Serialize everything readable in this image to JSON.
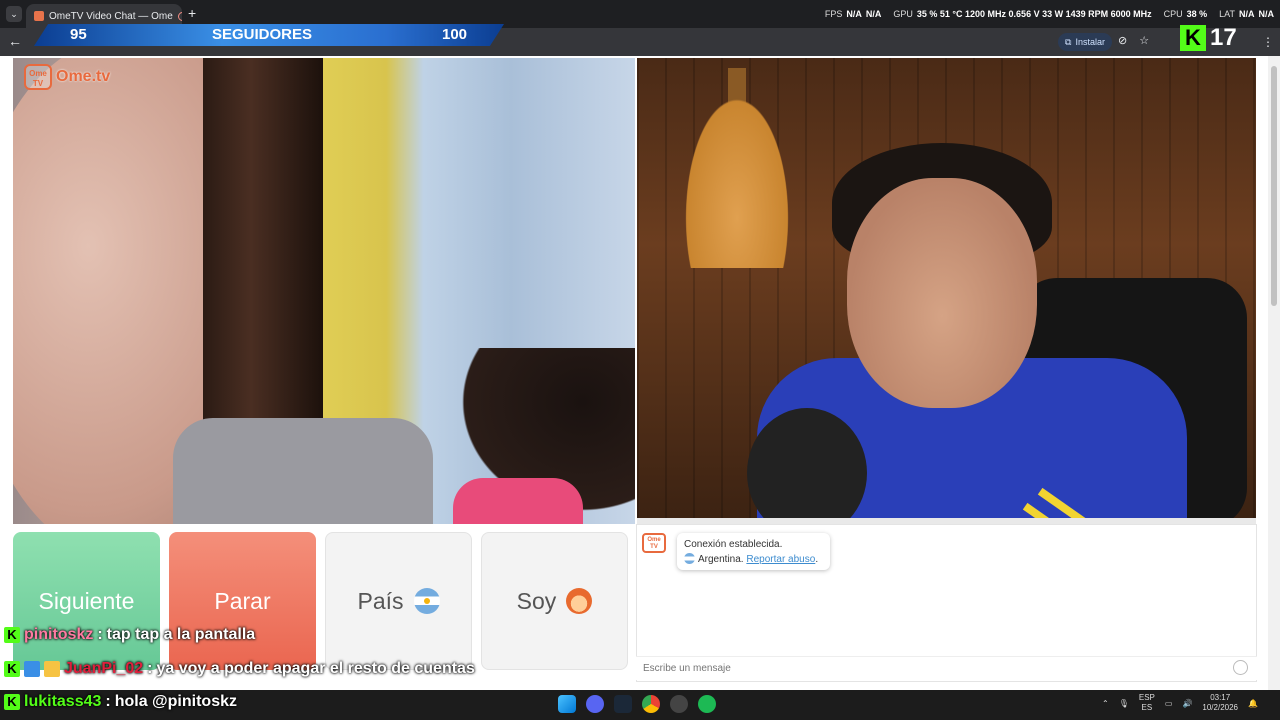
{
  "browser": {
    "tab_title": "OmeTV Video Chat — Ome",
    "new_tab": "+",
    "install_label": "Instalar"
  },
  "hud": {
    "fps_label": "FPS",
    "fps_val1": "N/A",
    "fps_val2": "N/A",
    "gpu_label": "GPU",
    "gpu_vals": "35 % 51 °C 1200 MHz 0.656 V 33 W 1439 RPM 6000 MHz",
    "cpu_label": "CPU",
    "cpu_val": "38 %",
    "lat_label": "LAT",
    "lat_val": "N/A",
    "lat_val2": "N/A"
  },
  "followers": {
    "current": "95",
    "label": "SEGUIDORES",
    "goal": "100"
  },
  "kick_badge": {
    "letter": "K",
    "count": "17"
  },
  "ome_logo": {
    "tv": "Ome TV",
    "text": "Ome.tv"
  },
  "buttons": {
    "next": "Siguiente",
    "stop": "Parar",
    "country": "País",
    "me": "Soy"
  },
  "chat": {
    "logo": "Ome TV",
    "status": "Conexión establecida.",
    "country": "Argentina.",
    "report": "Reportar abuso",
    "report_suffix": ".",
    "placeholder": "Escribe un mensaje"
  },
  "stream_chat": [
    {
      "user": "pinitoskz",
      "sep": ":",
      "text": "tap tap a la pantalla",
      "color": "#ff7aa2"
    },
    {
      "user": "JuanPi_02",
      "sep": ":",
      "text": "ya voy a poder apagar el resto de cuentas",
      "color": "#e0203c"
    },
    {
      "user": "lukitass43",
      "sep": ":",
      "text": "hola @pinitoskz",
      "color": "#53fc18"
    }
  ],
  "tray": {
    "lang1": "ESP",
    "lang2": "ES",
    "time": "03:17",
    "date": "10/2/2026"
  },
  "colors": {
    "kick_green": "#53fc18",
    "next_green": "#66c896",
    "stop_red": "#ea6650",
    "ome_orange": "#e86a3e"
  }
}
